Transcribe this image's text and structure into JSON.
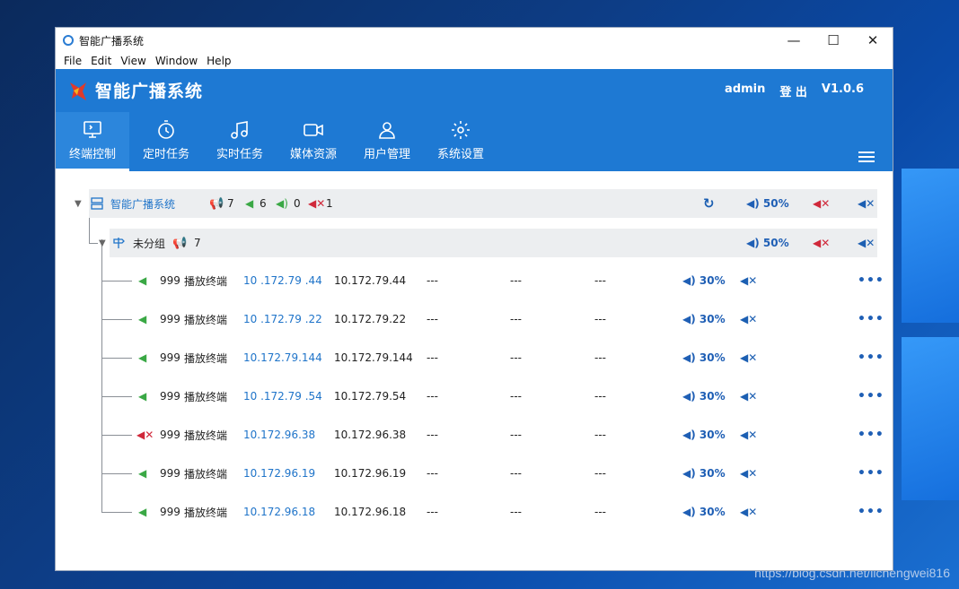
{
  "window": {
    "title": "智能广播系统"
  },
  "menu": [
    "File",
    "Edit",
    "View",
    "Window",
    "Help"
  ],
  "header": {
    "brand": "智能广播系统",
    "user": "admin",
    "logout": "登 出",
    "version": "V1.0.6"
  },
  "nav": [
    {
      "label": "终端控制",
      "icon": "terminal-icon",
      "active": true
    },
    {
      "label": "定时任务",
      "icon": "timer-icon"
    },
    {
      "label": "实时任务",
      "icon": "music-note-icon"
    },
    {
      "label": "媒体资源",
      "icon": "video-camera-icon"
    },
    {
      "label": "用户管理",
      "icon": "user-icon"
    },
    {
      "label": "系统设置",
      "icon": "gear-icon"
    }
  ],
  "root_group": {
    "name": "智能广播系统",
    "total": "7",
    "online": "6",
    "idle": "0",
    "offline": "1",
    "volume": "50%"
  },
  "sub_group": {
    "name": "未分组",
    "count": "7",
    "volume": "50%"
  },
  "terminals": [
    {
      "id": "999",
      "name": "播放终端",
      "ip": "10 .172.79 .44",
      "ip2": "10.172.79.44",
      "c1": "---",
      "c2": "---",
      "c3": "---",
      "volume": "30%",
      "status": "online"
    },
    {
      "id": "999",
      "name": "播放终端",
      "ip": "10 .172.79 .22",
      "ip2": "10.172.79.22",
      "c1": "---",
      "c2": "---",
      "c3": "---",
      "volume": "30%",
      "status": "online"
    },
    {
      "id": "999",
      "name": "播放终端",
      "ip": "10.172.79.144",
      "ip2": "10.172.79.144",
      "c1": "---",
      "c2": "---",
      "c3": "---",
      "volume": "30%",
      "status": "online"
    },
    {
      "id": "999",
      "name": "播放终端",
      "ip": "10 .172.79 .54",
      "ip2": "10.172.79.54",
      "c1": "---",
      "c2": "---",
      "c3": "---",
      "volume": "30%",
      "status": "online"
    },
    {
      "id": "999",
      "name": "播放终端",
      "ip": "10.172.96.38",
      "ip2": "10.172.96.38",
      "c1": "---",
      "c2": "---",
      "c3": "---",
      "volume": "30%",
      "status": "offline"
    },
    {
      "id": "999",
      "name": "播放终端",
      "ip": "10.172.96.19",
      "ip2": "10.172.96.19",
      "c1": "---",
      "c2": "---",
      "c3": "---",
      "volume": "30%",
      "status": "online"
    },
    {
      "id": "999",
      "name": "播放终端",
      "ip": "10.172.96.18",
      "ip2": "10.172.96.18",
      "c1": "---",
      "c2": "---",
      "c3": "---",
      "volume": "30%",
      "status": "online"
    }
  ],
  "watermark": "https://blog.csdn.net/lichengwei816",
  "colors": {
    "header": "#1e79d3",
    "accent": "#1f74c9",
    "online": "#3aa845",
    "offline": "#d0283a"
  }
}
